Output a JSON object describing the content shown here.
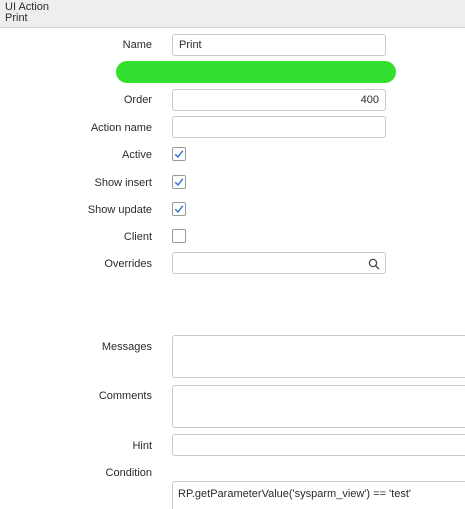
{
  "header": {
    "record_type": "UI Action",
    "record_name": "Print"
  },
  "form": {
    "name": {
      "label": "Name",
      "value": "Print"
    },
    "order": {
      "label": "Order",
      "value": "400"
    },
    "action_name": {
      "label": "Action name",
      "value": ""
    },
    "active": {
      "label": "Active",
      "checked": true
    },
    "show_insert": {
      "label": "Show insert",
      "checked": true
    },
    "show_update": {
      "label": "Show update",
      "checked": true
    },
    "client": {
      "label": "Client",
      "checked": false
    },
    "overrides": {
      "label": "Overrides",
      "value": ""
    },
    "messages": {
      "label": "Messages",
      "value": ""
    },
    "comments": {
      "label": "Comments",
      "value": ""
    },
    "hint": {
      "label": "Hint",
      "value": ""
    },
    "condition": {
      "label": "Condition",
      "value": "RP.getParameterValue('sysparm_view') == 'test'"
    }
  },
  "icons": {
    "checkmark": "check-icon",
    "search": "search-icon"
  },
  "colors": {
    "highlight_bar": "#33e02f",
    "checkmark": "#2e6fd1"
  }
}
